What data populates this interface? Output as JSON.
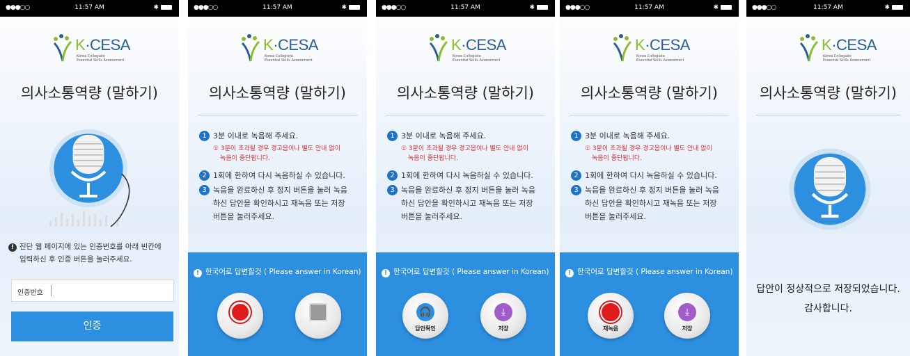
{
  "status": {
    "time": "11:57 AM",
    "signal": "●●●○○"
  },
  "logo": {
    "name_k": "K",
    "name_rest": "·CESA",
    "sub1": "Korea Collegiate",
    "sub2": "Essential Skills Assessment"
  },
  "title": "의사소통역량 (말하기)",
  "screen1": {
    "instruction_line1": "진단 웹 페이지에 있는 인증번호를 아래 빈칸에",
    "instruction_line2": "입력하신 후 인증 버튼을 눌러주세요.",
    "input_label": "인증번호",
    "button_label": "인증"
  },
  "instructions": [
    {
      "num": "1",
      "text": "3분 이내로 녹음해 주세요."
    },
    {
      "num": "2",
      "text": "1회에 한하여 다시 녹음하실 수 있습니다."
    },
    {
      "num": "3",
      "text_line1": "녹음을 완료하신 후 정지 버튼을 눌러 녹음",
      "text_line2": "하신 답안을 확인하시고 재녹음 또는 저장",
      "text_line3": "버튼을 눌러주세요."
    }
  ],
  "warning_line1": "① 3분이 초과될 경우 경고음이나 별도 안내 없이",
  "warning_line2": "녹음이 중단됩니다.",
  "notice": "한국어로 답변할것 ( Please answer in Korean)",
  "buttons": {
    "record": "record-icon",
    "stop": "stop-icon",
    "review_label": "답안확인",
    "save_label": "저장",
    "rerecord_label": "재녹음"
  },
  "screen5": {
    "done_line1": "답안이 정상적으로 저장되었습니다.",
    "done_line2": "감사합니다."
  }
}
